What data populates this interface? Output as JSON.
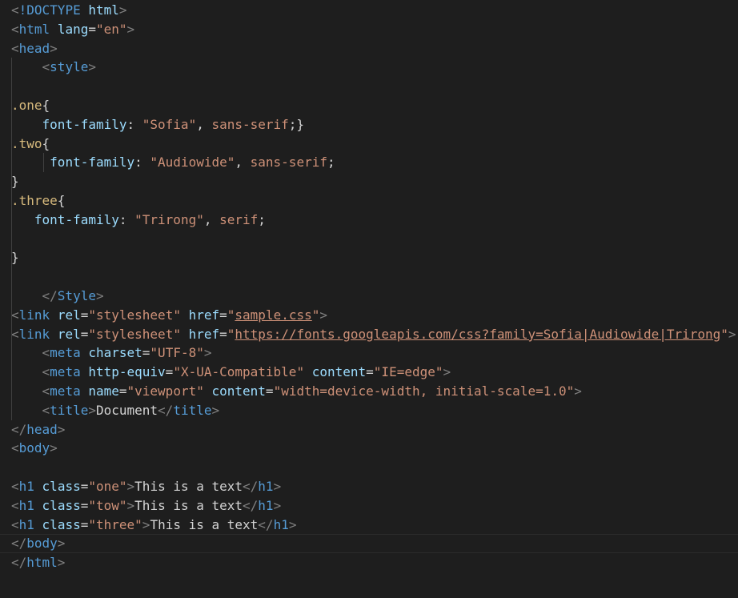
{
  "editor": {
    "theme_colors": {
      "background": "#1e1e1e",
      "punctuation": "#808080",
      "tag": "#569cd6",
      "attribute": "#9cdcfe",
      "string": "#ce9178",
      "selector": "#d7ba7d",
      "text": "#d4d4d4"
    },
    "lines": [
      {
        "tokens": [
          {
            "c": "punc",
            "t": "<"
          },
          {
            "c": "tag",
            "t": "!DOCTYPE"
          },
          {
            "c": "text",
            "t": " "
          },
          {
            "c": "attr",
            "t": "html"
          },
          {
            "c": "punc",
            "t": ">"
          }
        ]
      },
      {
        "tokens": [
          {
            "c": "punc",
            "t": "<"
          },
          {
            "c": "tag",
            "t": "html"
          },
          {
            "c": "text",
            "t": " "
          },
          {
            "c": "attr",
            "t": "lang"
          },
          {
            "c": "text",
            "t": "="
          },
          {
            "c": "str",
            "t": "\"en\""
          },
          {
            "c": "punc",
            "t": ">"
          }
        ]
      },
      {
        "tokens": [
          {
            "c": "punc",
            "t": "<"
          },
          {
            "c": "tag",
            "t": "head"
          },
          {
            "c": "punc",
            "t": ">"
          }
        ]
      },
      {
        "tokens": [
          {
            "c": "text",
            "t": "    "
          },
          {
            "c": "punc",
            "t": "<"
          },
          {
            "c": "tag",
            "t": "style"
          },
          {
            "c": "punc",
            "t": ">"
          }
        ]
      },
      {
        "tokens": []
      },
      {
        "tokens": [
          {
            "c": "sel",
            "t": ".one"
          },
          {
            "c": "text",
            "t": "{"
          }
        ]
      },
      {
        "tokens": [
          {
            "c": "text",
            "t": "    "
          },
          {
            "c": "prop",
            "t": "font-family"
          },
          {
            "c": "text",
            "t": ": "
          },
          {
            "c": "str",
            "t": "\"Sofia\""
          },
          {
            "c": "text",
            "t": ", "
          },
          {
            "c": "str",
            "t": "sans-serif"
          },
          {
            "c": "text",
            "t": ";}"
          }
        ]
      },
      {
        "tokens": [
          {
            "c": "sel",
            "t": ".two"
          },
          {
            "c": "text",
            "t": "{"
          }
        ]
      },
      {
        "tokens": [
          {
            "c": "text",
            "t": "     "
          },
          {
            "c": "prop",
            "t": "font-family"
          },
          {
            "c": "text",
            "t": ": "
          },
          {
            "c": "str",
            "t": "\"Audiowide\""
          },
          {
            "c": "text",
            "t": ", "
          },
          {
            "c": "str",
            "t": "sans-serif"
          },
          {
            "c": "text",
            "t": ";"
          }
        ]
      },
      {
        "tokens": [
          {
            "c": "text",
            "t": "}"
          }
        ]
      },
      {
        "tokens": [
          {
            "c": "sel",
            "t": ".three"
          },
          {
            "c": "text",
            "t": "{"
          }
        ]
      },
      {
        "tokens": [
          {
            "c": "text",
            "t": "   "
          },
          {
            "c": "prop",
            "t": "font-family"
          },
          {
            "c": "text",
            "t": ": "
          },
          {
            "c": "str",
            "t": "\"Trirong\""
          },
          {
            "c": "text",
            "t": ", "
          },
          {
            "c": "str",
            "t": "serif"
          },
          {
            "c": "text",
            "t": ";"
          }
        ]
      },
      {
        "tokens": []
      },
      {
        "tokens": [
          {
            "c": "text",
            "t": "}"
          }
        ]
      },
      {
        "tokens": []
      },
      {
        "tokens": [
          {
            "c": "text",
            "t": "    "
          },
          {
            "c": "punc",
            "t": "</"
          },
          {
            "c": "tag",
            "t": "Style"
          },
          {
            "c": "punc",
            "t": ">"
          }
        ]
      },
      {
        "tokens": [
          {
            "c": "punc",
            "t": "<"
          },
          {
            "c": "tag",
            "t": "link"
          },
          {
            "c": "text",
            "t": " "
          },
          {
            "c": "attr",
            "t": "rel"
          },
          {
            "c": "text",
            "t": "="
          },
          {
            "c": "str",
            "t": "\"stylesheet\""
          },
          {
            "c": "text",
            "t": " "
          },
          {
            "c": "attr",
            "t": "href"
          },
          {
            "c": "text",
            "t": "="
          },
          {
            "c": "str",
            "t": "\""
          },
          {
            "c": "link",
            "t": "sample.css"
          },
          {
            "c": "str",
            "t": "\""
          },
          {
            "c": "punc",
            "t": ">"
          }
        ]
      },
      {
        "tokens": [
          {
            "c": "punc",
            "t": "<"
          },
          {
            "c": "tag",
            "t": "link"
          },
          {
            "c": "text",
            "t": " "
          },
          {
            "c": "attr",
            "t": "rel"
          },
          {
            "c": "text",
            "t": "="
          },
          {
            "c": "str",
            "t": "\"stylesheet\""
          },
          {
            "c": "text",
            "t": " "
          },
          {
            "c": "attr",
            "t": "href"
          },
          {
            "c": "text",
            "t": "="
          },
          {
            "c": "str",
            "t": "\""
          },
          {
            "c": "link",
            "t": "https://fonts.googleapis.com/css?family=Sofia|Audiowide|Trirong"
          },
          {
            "c": "str",
            "t": "\""
          },
          {
            "c": "punc",
            "t": ">"
          }
        ]
      },
      {
        "tokens": [
          {
            "c": "text",
            "t": "    "
          },
          {
            "c": "punc",
            "t": "<"
          },
          {
            "c": "tag",
            "t": "meta"
          },
          {
            "c": "text",
            "t": " "
          },
          {
            "c": "attr",
            "t": "charset"
          },
          {
            "c": "text",
            "t": "="
          },
          {
            "c": "str",
            "t": "\"UTF-8\""
          },
          {
            "c": "punc",
            "t": ">"
          }
        ]
      },
      {
        "tokens": [
          {
            "c": "text",
            "t": "    "
          },
          {
            "c": "punc",
            "t": "<"
          },
          {
            "c": "tag",
            "t": "meta"
          },
          {
            "c": "text",
            "t": " "
          },
          {
            "c": "attr",
            "t": "http-equiv"
          },
          {
            "c": "text",
            "t": "="
          },
          {
            "c": "str",
            "t": "\"X-UA-Compatible\""
          },
          {
            "c": "text",
            "t": " "
          },
          {
            "c": "attr",
            "t": "content"
          },
          {
            "c": "text",
            "t": "="
          },
          {
            "c": "str",
            "t": "\"IE=edge\""
          },
          {
            "c": "punc",
            "t": ">"
          }
        ]
      },
      {
        "tokens": [
          {
            "c": "text",
            "t": "    "
          },
          {
            "c": "punc",
            "t": "<"
          },
          {
            "c": "tag",
            "t": "meta"
          },
          {
            "c": "text",
            "t": " "
          },
          {
            "c": "attr",
            "t": "name"
          },
          {
            "c": "text",
            "t": "="
          },
          {
            "c": "str",
            "t": "\"viewport\""
          },
          {
            "c": "text",
            "t": " "
          },
          {
            "c": "attr",
            "t": "content"
          },
          {
            "c": "text",
            "t": "="
          },
          {
            "c": "str",
            "t": "\"width=device-width, initial-scale=1.0\""
          },
          {
            "c": "punc",
            "t": ">"
          }
        ]
      },
      {
        "tokens": [
          {
            "c": "text",
            "t": "    "
          },
          {
            "c": "punc",
            "t": "<"
          },
          {
            "c": "tag",
            "t": "title"
          },
          {
            "c": "punc",
            "t": ">"
          },
          {
            "c": "text",
            "t": "Document"
          },
          {
            "c": "punc",
            "t": "</"
          },
          {
            "c": "tag",
            "t": "title"
          },
          {
            "c": "punc",
            "t": ">"
          }
        ]
      },
      {
        "tokens": [
          {
            "c": "punc",
            "t": "</"
          },
          {
            "c": "tag",
            "t": "head"
          },
          {
            "c": "punc",
            "t": ">"
          }
        ]
      },
      {
        "tokens": [
          {
            "c": "punc",
            "t": "<"
          },
          {
            "c": "tag",
            "t": "body"
          },
          {
            "c": "punc",
            "t": ">"
          }
        ]
      },
      {
        "tokens": []
      },
      {
        "tokens": [
          {
            "c": "punc",
            "t": "<"
          },
          {
            "c": "tag",
            "t": "h1"
          },
          {
            "c": "text",
            "t": " "
          },
          {
            "c": "attr",
            "t": "class"
          },
          {
            "c": "text",
            "t": "="
          },
          {
            "c": "str",
            "t": "\"one\""
          },
          {
            "c": "punc",
            "t": ">"
          },
          {
            "c": "text",
            "t": "This is a text"
          },
          {
            "c": "punc",
            "t": "</"
          },
          {
            "c": "tag",
            "t": "h1"
          },
          {
            "c": "punc",
            "t": ">"
          }
        ]
      },
      {
        "tokens": [
          {
            "c": "punc",
            "t": "<"
          },
          {
            "c": "tag",
            "t": "h1"
          },
          {
            "c": "text",
            "t": " "
          },
          {
            "c": "attr",
            "t": "class"
          },
          {
            "c": "text",
            "t": "="
          },
          {
            "c": "str",
            "t": "\"tow\""
          },
          {
            "c": "punc",
            "t": ">"
          },
          {
            "c": "text",
            "t": "This is a text"
          },
          {
            "c": "punc",
            "t": "</"
          },
          {
            "c": "tag",
            "t": "h1"
          },
          {
            "c": "punc",
            "t": ">"
          }
        ]
      },
      {
        "tokens": [
          {
            "c": "punc",
            "t": "<"
          },
          {
            "c": "tag",
            "t": "h1"
          },
          {
            "c": "text",
            "t": " "
          },
          {
            "c": "attr",
            "t": "class"
          },
          {
            "c": "text",
            "t": "="
          },
          {
            "c": "str",
            "t": "\"three\""
          },
          {
            "c": "punc",
            "t": ">"
          },
          {
            "c": "text",
            "t": "This is a text"
          },
          {
            "c": "punc",
            "t": "</"
          },
          {
            "c": "tag",
            "t": "h1"
          },
          {
            "c": "punc",
            "t": ">"
          }
        ]
      },
      {
        "tokens": [
          {
            "c": "punc",
            "t": "</"
          },
          {
            "c": "tag",
            "t": "body"
          },
          {
            "c": "punc",
            "t": ">"
          }
        ],
        "current": true
      },
      {
        "tokens": [
          {
            "c": "punc",
            "t": "</"
          },
          {
            "c": "tag",
            "t": "html"
          },
          {
            "c": "punc",
            "t": ">"
          }
        ]
      }
    ]
  }
}
